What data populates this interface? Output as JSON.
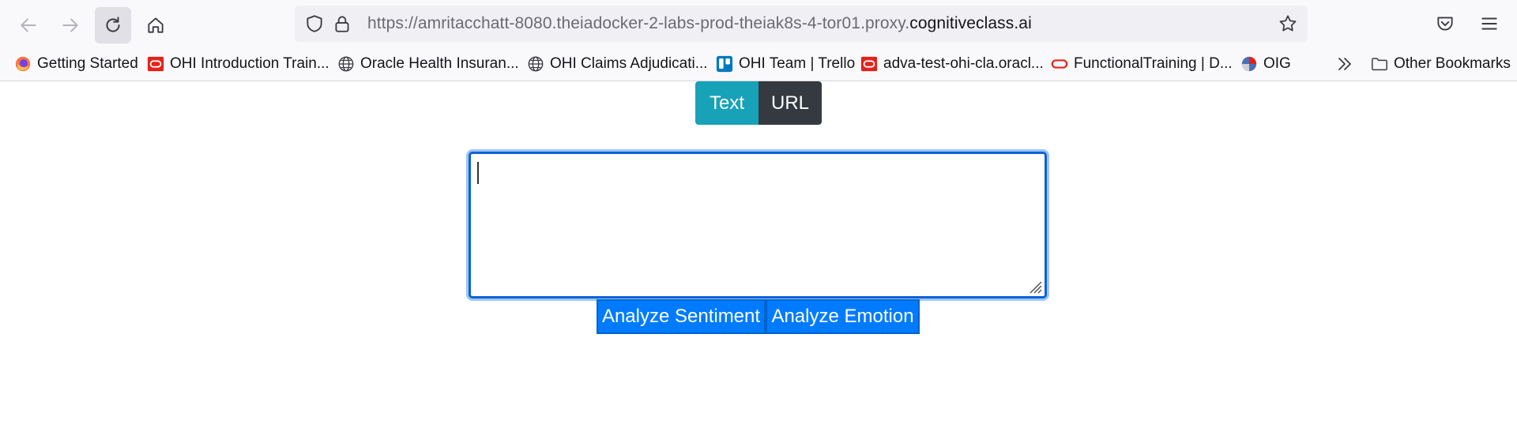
{
  "browser": {
    "url_prefix": "https://amritacchatt-8080.theiadocker-2-labs-prod-theiak8s-4-tor01.proxy.",
    "url_domain": "cognitiveclass.ai"
  },
  "bookmarks": [
    {
      "label": "Getting Started",
      "icon": "firefox-icon"
    },
    {
      "label": "OHI Introduction Train...",
      "icon": "oracle-icon"
    },
    {
      "label": "Oracle Health Insuran...",
      "icon": "globe-icon"
    },
    {
      "label": "OHI Claims Adjudicati...",
      "icon": "globe-icon"
    },
    {
      "label": "OHI Team | Trello",
      "icon": "trello-icon"
    },
    {
      "label": "adva-test-ohi-cla.oracl...",
      "icon": "oracle-icon"
    },
    {
      "label": "FunctionalTraining | D...",
      "icon": "oracle-outline-icon"
    },
    {
      "label": "OIG",
      "icon": "oig-icon"
    }
  ],
  "other_bookmarks": "Other Bookmarks",
  "page": {
    "tab_text_label": "Text",
    "tab_url_label": "URL",
    "textarea_value": "",
    "analyze_sentiment_label": "Analyze Sentiment",
    "analyze_emotion_label": "Analyze Emotion"
  },
  "colors": {
    "text_tab": "#17a2b8",
    "url_tab": "#343a40",
    "primary_button": "#007bff",
    "textarea_focus": "#0b62d6"
  }
}
